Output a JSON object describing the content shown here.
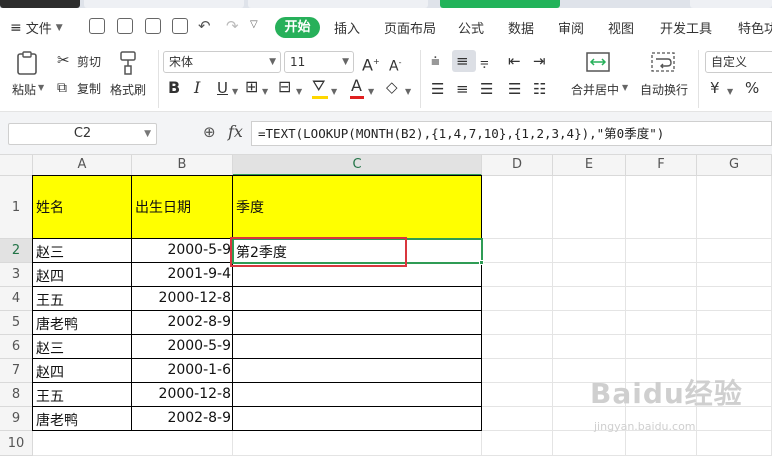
{
  "menu": {
    "file_label": "文件",
    "start_label": "开始",
    "tabs": [
      "插入",
      "页面布局",
      "公式",
      "数据",
      "审阅",
      "视图",
      "开发工具",
      "特色功"
    ]
  },
  "ribbon": {
    "paste_label": "粘贴",
    "cut_label": "剪切",
    "copy_label": "复制",
    "format_painter_label": "格式刷",
    "font_name": "宋体",
    "font_size": "11",
    "merge_center_label": "合并居中",
    "wrap_text_label": "自动换行",
    "number_format": "自定义",
    "currency_symbol": "¥",
    "percent_symbol": "%"
  },
  "formula_bar": {
    "name_box": "C2",
    "fx_label": "fx",
    "formula": "=TEXT(LOOKUP(MONTH(B2),{1,4,7,10},{1,2,3,4}),\"第0季度\")"
  },
  "sheet": {
    "columns": [
      "A",
      "B",
      "C",
      "D",
      "E",
      "F",
      "G"
    ],
    "rows": [
      "1",
      "2",
      "3",
      "4",
      "5",
      "6",
      "7",
      "8",
      "9",
      "10"
    ],
    "headers": [
      "姓名",
      "出生日期",
      "季度"
    ],
    "data": [
      {
        "name": "赵三",
        "date": "2000-5-9",
        "quarter": "第2季度"
      },
      {
        "name": "赵四",
        "date": "2001-9-4",
        "quarter": ""
      },
      {
        "name": "王五",
        "date": "2000-12-8",
        "quarter": ""
      },
      {
        "name": "唐老鸭",
        "date": "2002-8-9",
        "quarter": ""
      },
      {
        "name": "赵三",
        "date": "2000-5-9",
        "quarter": ""
      },
      {
        "name": "赵四",
        "date": "2000-1-6",
        "quarter": ""
      },
      {
        "name": "王五",
        "date": "2000-12-8",
        "quarter": ""
      },
      {
        "name": "唐老鸭",
        "date": "2002-8-9",
        "quarter": ""
      }
    ]
  },
  "watermark": {
    "brand": "Baidu经验",
    "url": "jingyan.baidu.com"
  },
  "colors": {
    "accent_green": "#27b05a",
    "header_fill": "#ffff00",
    "highlight_red": "#d9363e"
  }
}
